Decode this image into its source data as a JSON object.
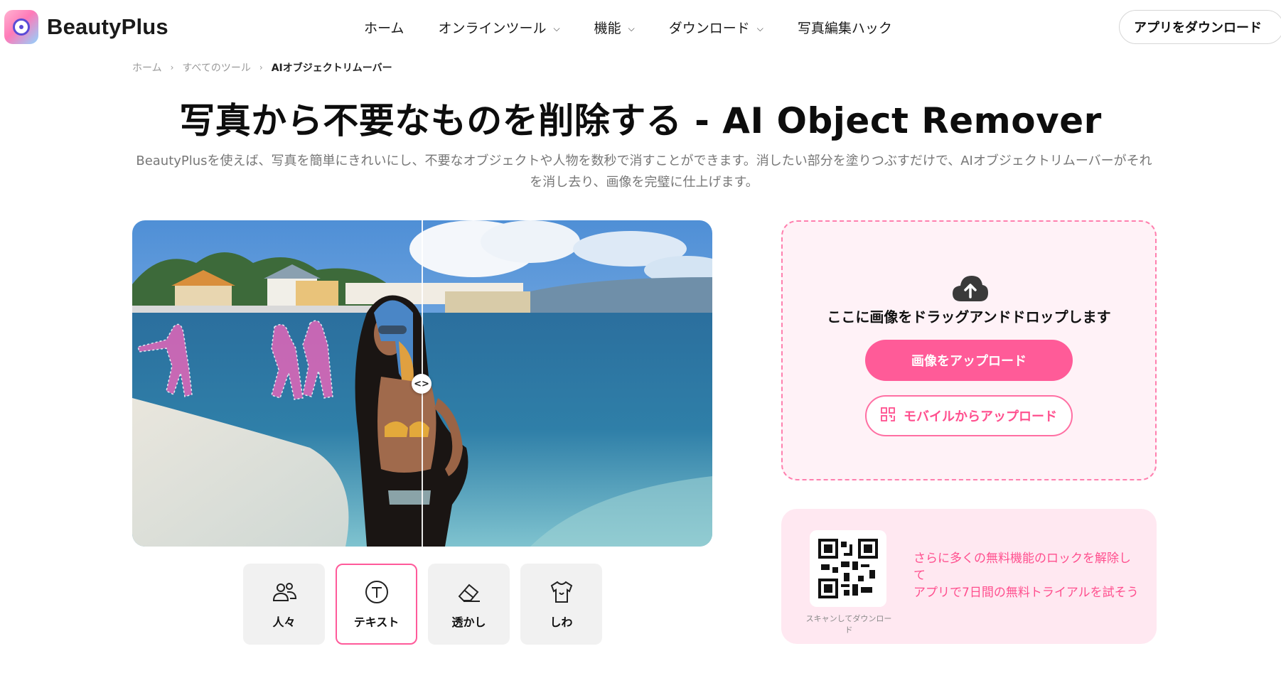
{
  "brand": {
    "name": "BeautyPlus"
  },
  "nav": {
    "items": [
      {
        "label": "ホーム",
        "has_menu": false
      },
      {
        "label": "オンラインツール",
        "has_menu": true
      },
      {
        "label": "機能",
        "has_menu": true
      },
      {
        "label": "ダウンロード",
        "has_menu": true
      },
      {
        "label": "写真編集ハック",
        "has_menu": false
      }
    ],
    "download_app": "アプリをダウンロード"
  },
  "breadcrumb": {
    "home": "ホーム",
    "tools": "すべてのツール",
    "current": "AIオブジェクトリムーバー"
  },
  "hero": {
    "title": "写真から不要なものを削除する - AI Object Remover",
    "description": "BeautyPlusを使えば、写真を簡単にきれいにし、不要なオブジェクトや人物を数秒で消すことができます。消したい部分を塗りつぶすだけで、AIオブジェクトリムーバーがそれを消し去り、画像を完璧に仕上げます。"
  },
  "compare": {
    "handle": "<>"
  },
  "categories": [
    {
      "label": "人々",
      "icon": "people-icon",
      "active": false
    },
    {
      "label": "テキスト",
      "icon": "text-icon",
      "active": true
    },
    {
      "label": "透かし",
      "icon": "eraser-icon",
      "active": false
    },
    {
      "label": "しわ",
      "icon": "shirt-icon",
      "active": false
    }
  ],
  "upload": {
    "drop_text": "ここに画像をドラッグアンドドロップします",
    "upload_button": "画像をアップロード",
    "mobile_button": "モバイルからアップロード"
  },
  "promo": {
    "qr_caption": "スキャンしてダウンロード",
    "line1": "さらに多くの無料機能のロックを解除して",
    "line2": "アプリで7日間の無料トライアルを試そう"
  },
  "colors": {
    "accent": "#ff5b98",
    "panel": "#fff2f7",
    "promo": "#ffe8f1"
  }
}
